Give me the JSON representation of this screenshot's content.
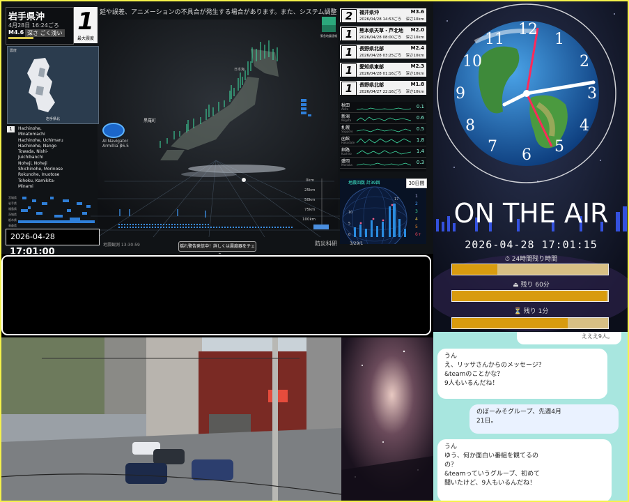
{
  "quake": {
    "ticker": "延や誤差、アニメーションの不具合が発生する場合があります。また、システム調整等のため、配信が",
    "region": "岩手県沖",
    "datetime": "4月28日 16:24ごろ",
    "magnitude": "M4.6",
    "depth": "深さ ごく浅い",
    "intensity": "1",
    "intensity_label": "最大震度",
    "minimap_label": "震度",
    "minimap_sub": "岩手県北",
    "list_badge": "1",
    "cities": [
      "Hachinohe,",
      "Minatomachi",
      "Hachinohe, Uchimaru",
      "Hachinohe, Nango",
      "Towada, Nishi-",
      "Juichibanchi",
      "Noheji, Noheji",
      "Shichinohe, Morinose",
      "Rokunohe, Inuotose",
      "Tohoku, Kamikita-",
      "Minami"
    ],
    "ai_label_1": "AI Navigator",
    "ai_label_2": "Armillia β6.5",
    "clock_date": "2026-04-28",
    "clock_time": "17:01:00",
    "jump_button": "揺れ警告発信中！詳しくは震度器をチェック",
    "obs_time": "地震観測 13:30:59",
    "nied": "防災科研",
    "eew_label": "緊急地震速報",
    "map_label": "黒羅町",
    "map_label2": "日本海",
    "distances": [
      "0km",
      "25km",
      "50km",
      "75km",
      "100km"
    ],
    "recent": [
      {
        "num": "2",
        "region": "福井県沖",
        "mag": "M3.6",
        "time": "2026/04/28 14:53ごろ",
        "depth": "深さ10km"
      },
      {
        "num": "1",
        "region": "熊本県天草・芦北地",
        "mag": "M2.0",
        "time": "2026/04/28 08:00ごろ",
        "depth": "深さ10km"
      },
      {
        "num": "1",
        "region": "長野県北部",
        "mag": "M2.4",
        "time": "2026/04/28 03:25ごろ",
        "depth": "深さ10km"
      },
      {
        "num": "1",
        "region": "愛知県東部",
        "mag": "M2.3",
        "time": "2026/04/28 01:16ごろ",
        "depth": "深さ10km"
      },
      {
        "num": "1",
        "region": "長野県北部",
        "mag": "M1.8",
        "time": "2026/04/27 22:16ごろ",
        "depth": "深さ10km"
      }
    ],
    "stations": [
      {
        "name": "秋田",
        "sub": "Akita",
        "value": "0.1"
      },
      {
        "name": "新潟",
        "sub": "Niigata",
        "value": "0.6"
      },
      {
        "name": "札幌",
        "sub": "Sapporo",
        "value": "0.5"
      },
      {
        "name": "函館",
        "sub": "Hakodate",
        "value": "1.8"
      },
      {
        "name": "釧路",
        "sub": "Kushiro",
        "value": "1.4"
      },
      {
        "name": "盛岡",
        "sub": "Morioka",
        "value": "0.3"
      }
    ],
    "globe_title": "地震回数 計39回",
    "globe_button": "30日間",
    "globe_date": "3/29/1",
    "globe_scale": [
      "1",
      "2",
      "3",
      "4",
      "5",
      "6+"
    ],
    "globe_yticks": [
      "17",
      "10",
      "5",
      "0"
    ]
  },
  "clock": {
    "numbers": [
      "12",
      "1",
      "2",
      "3",
      "4",
      "5",
      "6",
      "7",
      "8",
      "9",
      "10",
      "11"
    ],
    "on_air": "ON THE AIR",
    "datetime": "2026-04-28 17:01:15",
    "bars": [
      {
        "label": "24時間残り時間",
        "value": 0.29
      },
      {
        "label": "残り 60分",
        "value": 0.99
      },
      {
        "label": "残り 1分",
        "value": 0.74
      }
    ]
  },
  "chat": {
    "top_fragment": "えええ9人。",
    "messages": [
      {
        "text": "うん\nえ、リッサさんからのメッセージ？\n&teamのことかな？\n9人もいるんだね！",
        "me": false
      },
      {
        "text": "のぼーみそグループ、先週4月\n21日。",
        "me": true
      },
      {
        "text": "うん\nゆう、何か面白い番組を観てるの\nの？\n&teamっていうグループ、初めて\n聞いたけど、9人もいるんだね！",
        "me": false
      }
    ]
  },
  "colors": {
    "accent_yellow": "#f5f24a",
    "bar_fill": "#d89b0f",
    "bar_bg": "#d7bf84",
    "chat_bg": "#a8e6df"
  }
}
